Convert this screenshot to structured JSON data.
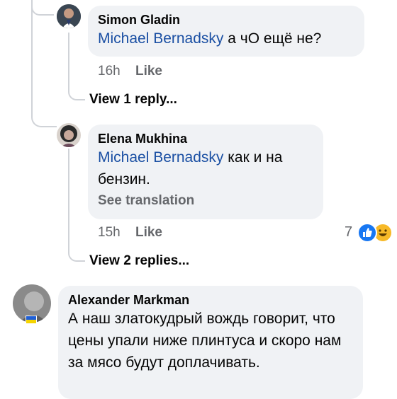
{
  "comments": [
    {
      "author": "Simon Gladin",
      "mention": "Michael Bernadsky",
      "text": "а чО ещё не?",
      "time": "16h",
      "like_label": "Like",
      "replies_label": "View 1 reply..."
    },
    {
      "author": "Elena Mukhina",
      "mention": "Michael Bernadsky",
      "text": "как и на бензин.",
      "see_translation": "See translation",
      "time": "15h",
      "like_label": "Like",
      "reaction_count": "7",
      "replies_label": "View 2 replies..."
    },
    {
      "author": "Alexander Markman",
      "text": "А наш златокудрый вождь говорит, что цены упали ниже плинтуса и скоро нам за мясо будут доплачивать."
    }
  ],
  "icons": {
    "like_reaction": "thumbs-up-icon",
    "haha_reaction": "laughing-face-icon",
    "badge": "ukraine-flag-icon"
  },
  "colors": {
    "bubble": "#f0f2f5",
    "mention": "#1a4fa3",
    "meta": "#65676b",
    "like_blue": "#1877f2",
    "haha_yellow": "#f7b928"
  }
}
